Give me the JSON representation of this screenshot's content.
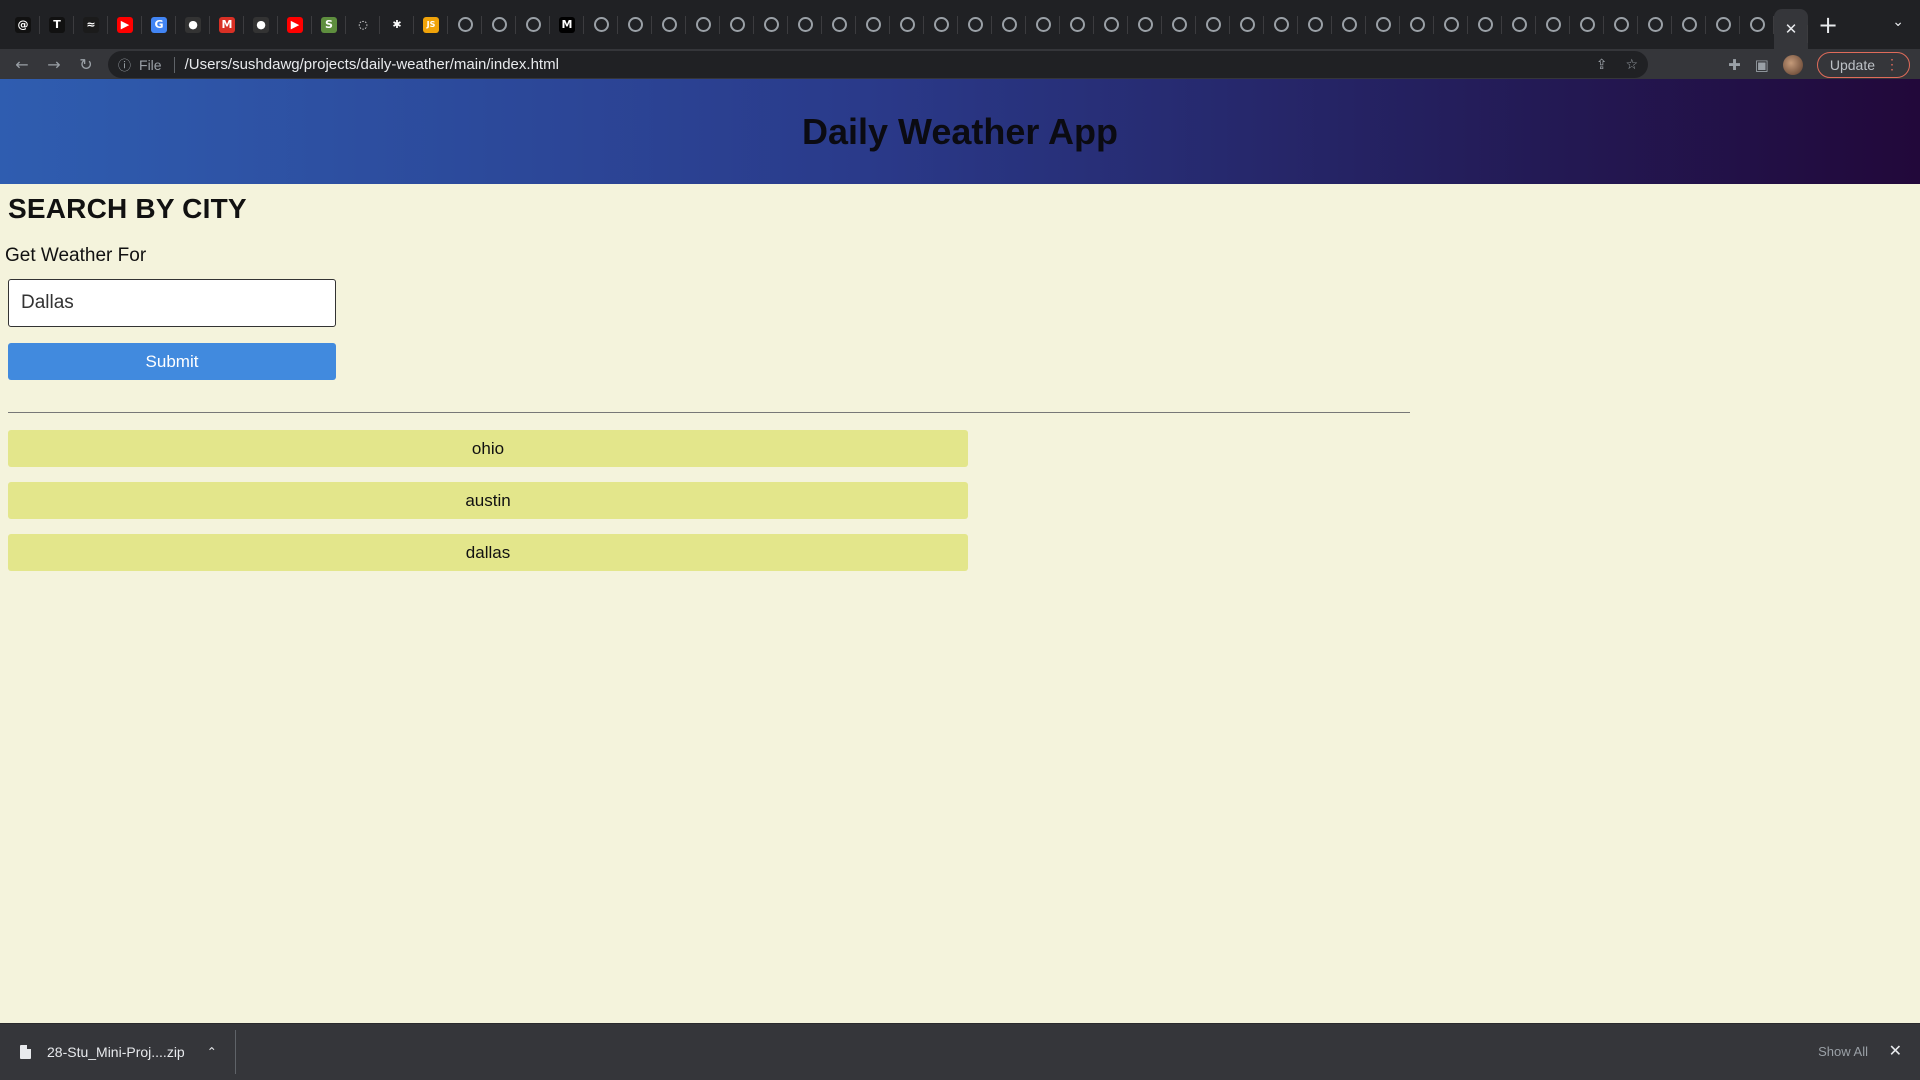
{
  "browser": {
    "tabs": [
      {
        "icon": "threads-icon",
        "glyph": "@",
        "color": "#111111"
      },
      {
        "icon": "t-icon",
        "glyph": "T",
        "color": "#111111"
      },
      {
        "icon": "dna-icon",
        "glyph": "≈",
        "color": "#1b1b1b"
      },
      {
        "icon": "youtube-icon",
        "glyph": "▶",
        "color": "#ff0000"
      },
      {
        "icon": "google-icon",
        "glyph": "G",
        "color": "#4285f4"
      },
      {
        "icon": "github-icon",
        "glyph": "●",
        "color": "#333333"
      },
      {
        "icon": "gmail-icon",
        "glyph": "M",
        "color": "#d93025"
      },
      {
        "icon": "github-icon",
        "glyph": "●",
        "color": "#333333"
      },
      {
        "icon": "youtube-icon",
        "glyph": "▶",
        "color": "#ff0000"
      },
      {
        "icon": "shopify-icon",
        "glyph": "S",
        "color": "#5e8e3e"
      },
      {
        "icon": "ring-icon",
        "glyph": "◌",
        "color": "#202124"
      },
      {
        "icon": "burst-icon",
        "glyph": "✱",
        "color": "#202124"
      },
      {
        "icon": "js-icon",
        "glyph": "JS",
        "color": "#f0a30a"
      },
      {
        "icon": "globe-icon",
        "glyph": "",
        "color": ""
      },
      {
        "icon": "globe-icon",
        "glyph": "",
        "color": ""
      },
      {
        "icon": "globe-icon",
        "glyph": "",
        "color": ""
      },
      {
        "icon": "m-icon",
        "glyph": "M",
        "color": "#000000"
      },
      {
        "icon": "globe-icon",
        "glyph": "",
        "color": ""
      },
      {
        "icon": "globe-icon",
        "glyph": "",
        "color": ""
      },
      {
        "icon": "globe-icon",
        "glyph": "",
        "color": ""
      },
      {
        "icon": "globe-icon",
        "glyph": "",
        "color": ""
      },
      {
        "icon": "globe-icon",
        "glyph": "",
        "color": ""
      },
      {
        "icon": "globe-icon",
        "glyph": "",
        "color": ""
      },
      {
        "icon": "globe-icon",
        "glyph": "",
        "color": ""
      },
      {
        "icon": "globe-icon",
        "glyph": "",
        "color": ""
      },
      {
        "icon": "globe-icon",
        "glyph": "",
        "color": ""
      },
      {
        "icon": "globe-icon",
        "glyph": "",
        "color": ""
      },
      {
        "icon": "globe-icon",
        "glyph": "",
        "color": ""
      },
      {
        "icon": "globe-icon",
        "glyph": "",
        "color": ""
      },
      {
        "icon": "globe-icon",
        "glyph": "",
        "color": ""
      },
      {
        "icon": "globe-icon",
        "glyph": "",
        "color": ""
      },
      {
        "icon": "globe-icon",
        "glyph": "",
        "color": ""
      },
      {
        "icon": "globe-icon",
        "glyph": "",
        "color": ""
      },
      {
        "icon": "globe-icon",
        "glyph": "",
        "color": ""
      },
      {
        "icon": "globe-icon",
        "glyph": "",
        "color": ""
      },
      {
        "icon": "globe-icon",
        "glyph": "",
        "color": ""
      },
      {
        "icon": "globe-icon",
        "glyph": "",
        "color": ""
      },
      {
        "icon": "globe-icon",
        "glyph": "",
        "color": ""
      },
      {
        "icon": "globe-icon",
        "glyph": "",
        "color": ""
      },
      {
        "icon": "globe-icon",
        "glyph": "",
        "color": ""
      },
      {
        "icon": "globe-icon",
        "glyph": "",
        "color": ""
      },
      {
        "icon": "globe-icon",
        "glyph": "",
        "color": ""
      },
      {
        "icon": "globe-icon",
        "glyph": "",
        "color": ""
      },
      {
        "icon": "globe-icon",
        "glyph": "",
        "color": ""
      },
      {
        "icon": "globe-icon",
        "glyph": "",
        "color": ""
      },
      {
        "icon": "globe-icon",
        "glyph": "",
        "color": ""
      },
      {
        "icon": "globe-icon",
        "glyph": "",
        "color": ""
      },
      {
        "icon": "globe-icon",
        "glyph": "",
        "color": ""
      },
      {
        "icon": "globe-icon",
        "glyph": "",
        "color": ""
      },
      {
        "icon": "globe-icon",
        "glyph": "",
        "color": ""
      },
      {
        "icon": "globe-icon",
        "glyph": "",
        "color": ""
      },
      {
        "icon": "globe-icon",
        "glyph": "",
        "color": ""
      }
    ],
    "url_scheme": "File",
    "url": "/Users/sushdawg/projects/daily-weather/main/index.html",
    "update_label": "Update"
  },
  "app": {
    "title": "Daily Weather App",
    "header_gradient": [
      "#2f5db0",
      "#22083a"
    ],
    "background": "#f4f3dc"
  },
  "search": {
    "heading": "SEARCH BY CITY",
    "label": "Get Weather For",
    "input_value": "Dallas",
    "submit_label": "Submit",
    "submit_color": "#418ade"
  },
  "history": {
    "item_color": "#e3e68b",
    "items": [
      "ohio",
      "austin",
      "dallas"
    ]
  },
  "downloads": {
    "file_name": "28-Stu_Mini-Proj....zip",
    "show_all_label": "Show All"
  }
}
